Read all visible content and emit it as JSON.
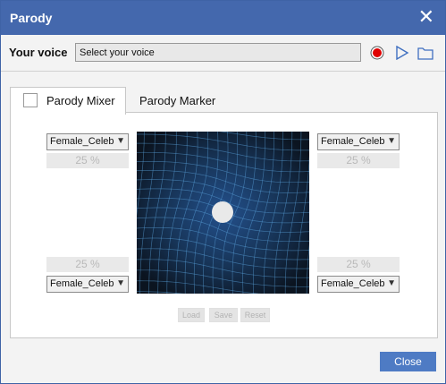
{
  "window": {
    "title": "Parody",
    "close_glyph": "✕"
  },
  "voice": {
    "label": "Your voice",
    "value": "Select your voice",
    "icons": [
      "record-icon",
      "play-icon",
      "folder-icon"
    ]
  },
  "tabs": [
    {
      "label": "Parody Mixer",
      "selected": true,
      "checked": false
    },
    {
      "label": "Parody Marker",
      "selected": false
    }
  ],
  "mixer": {
    "voices": {
      "top_left": "Female_Celebrity",
      "top_right": "Female_Celebrity",
      "bottom_left": "Female_Celebrity",
      "bottom_right": "Female_Celebrity"
    },
    "percentages": {
      "top_left": "25 %",
      "top_right": "25 %",
      "bottom_left": "25 %",
      "bottom_right": "25 %"
    },
    "buttons": {
      "load": "Load",
      "save": "Save",
      "reset": "Reset"
    }
  },
  "footer": {
    "close_label": "Close"
  },
  "colors": {
    "titlebar": "#4468ad",
    "accent_button": "#4e7bc4",
    "record": "#e00000",
    "grid_line": "#5aa0d8"
  }
}
